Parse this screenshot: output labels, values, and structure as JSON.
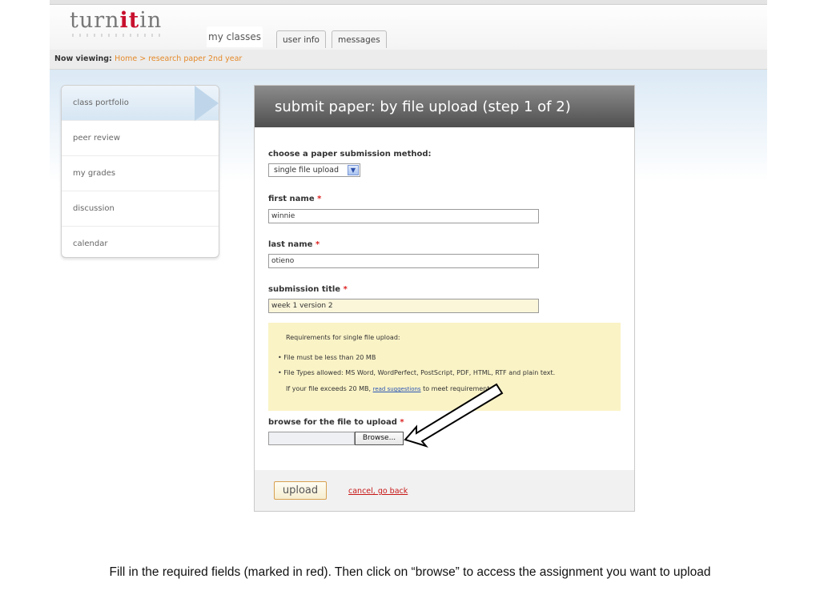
{
  "app": {
    "logo_pre": "turn",
    "logo_it": "it",
    "logo_post": "in"
  },
  "tabs": [
    {
      "label": "my classes"
    },
    {
      "label": "user info"
    },
    {
      "label": "messages"
    }
  ],
  "breadcrumb": {
    "prefix": "Now viewing:",
    "trail": "Home > research paper 2nd year"
  },
  "sidebar": {
    "items": [
      {
        "label": "class portfolio"
      },
      {
        "label": "peer review"
      },
      {
        "label": "my grades"
      },
      {
        "label": "discussion"
      },
      {
        "label": "calendar"
      }
    ]
  },
  "form": {
    "title": "submit paper: by file upload (step 1 of 2)",
    "method_label": "choose a paper submission method:",
    "method_value": "single file upload",
    "first_name_label": "first name",
    "first_name_value": "winnie",
    "last_name_label": "last name",
    "last_name_value": "otieno",
    "title_label": "submission title",
    "title_value": "week 1 version 2",
    "required_mark": "*",
    "requirements": {
      "heading": "Requirements for single file upload:",
      "items": [
        "File must be less than 20 MB",
        "File Types allowed: MS Word, WordPerfect, PostScript, PDF, HTML, RTF and plain text."
      ],
      "note_pre": "If your file exceeds 20 MB,",
      "note_link": "read suggestions",
      "note_post": "to meet requirements"
    },
    "browse_label": "browse for the file to upload",
    "browse_button": "Browse...",
    "upload_button": "upload",
    "cancel_link": "cancel, go back"
  },
  "caption": "Fill in the required fields (marked in red). Then click on “browse” to access the assignment you want to upload",
  "colors": {
    "header_gradient_dark": "#4f4f4f",
    "required": "#d22222",
    "breadcrumb_link": "#e58a2b",
    "requirements_bg": "#faf3c6"
  }
}
